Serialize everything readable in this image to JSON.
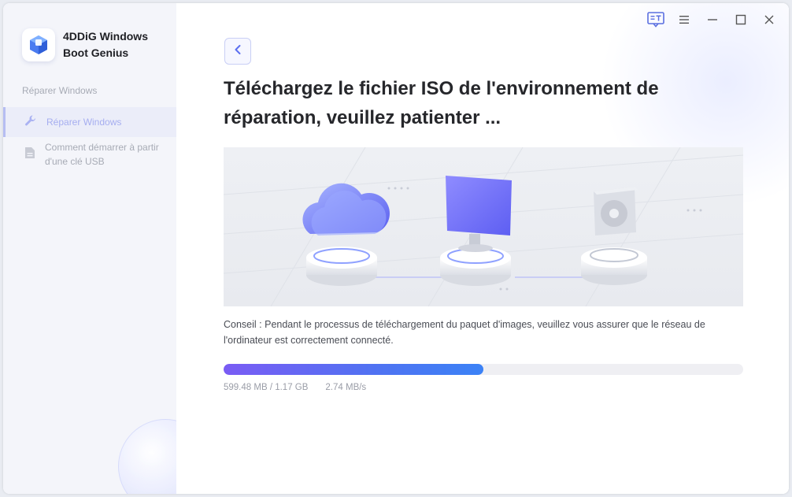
{
  "app": {
    "name_line1": "4DDiG Windows",
    "name_line2": "Boot Genius"
  },
  "sidebar": {
    "section_label": "Réparer Windows",
    "items": [
      {
        "label": "Réparer Windows",
        "icon": "wrench-icon",
        "active": true
      },
      {
        "label": "Comment démarrer à partir d'une clé USB",
        "icon": "document-icon",
        "active": false
      }
    ]
  },
  "titlebar": {
    "icons": [
      "feedback-icon",
      "menu-icon",
      "minimize-icon",
      "maximize-icon",
      "close-icon"
    ]
  },
  "main": {
    "title": "Téléchargez le fichier ISO de l'environnement de réparation, veuillez patienter ...",
    "tip": "Conseil : Pendant le processus de téléchargement du paquet d'images, veuillez vous assurer que le réseau de l'ordinateur est correctement connecté.",
    "progress": {
      "fraction": 0.5,
      "downloaded": "599.48 MB / 1.17 GB",
      "speed": "2.74 MB/s"
    }
  },
  "colors": {
    "accent": "#4f73f2",
    "accent_start": "#7a5cf4",
    "sidebar_bg": "#f4f5fa",
    "active_item_bg": "#ebedf9"
  }
}
